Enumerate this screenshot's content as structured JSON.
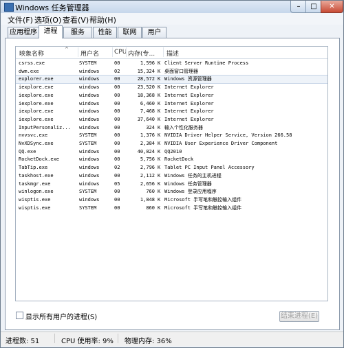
{
  "window": {
    "title": "Windows 任务管理器",
    "controls": {
      "minimize": "–",
      "maximize": "□",
      "close": "✕"
    }
  },
  "menu": [
    "文件(F)",
    "选项(O)",
    "查看(V)",
    "帮助(H)"
  ],
  "tabs": [
    "应用程序",
    "进程",
    "服务",
    "性能",
    "联网",
    "用户"
  ],
  "active_tab": "进程",
  "columns": {
    "name": "映象名称",
    "user": "用户名",
    "cpu": "CPU",
    "mem": "内存(专...",
    "desc": "描述"
  },
  "processes": [
    {
      "name": "csrss.exe",
      "user": "SYSTEM",
      "cpu": "00",
      "mem": "1,596",
      "unit": "K",
      "desc": "Client Server Runtime Process"
    },
    {
      "name": "dwm.exe",
      "user": "windows",
      "cpu": "02",
      "mem": "15,324",
      "unit": "K",
      "desc": "桌面窗口管理器"
    },
    {
      "name": "explorer.exe",
      "user": "windows",
      "cpu": "00",
      "mem": "28,572",
      "unit": "K",
      "desc": "Windows 资源管理器"
    },
    {
      "name": "iexplore.exe",
      "user": "windows",
      "cpu": "00",
      "mem": "23,520",
      "unit": "K",
      "desc": "Internet Explorer"
    },
    {
      "name": "iexplore.exe",
      "user": "windows",
      "cpu": "00",
      "mem": "18,368",
      "unit": "K",
      "desc": "Internet Explorer"
    },
    {
      "name": "iexplore.exe",
      "user": "windows",
      "cpu": "00",
      "mem": "6,460",
      "unit": "K",
      "desc": "Internet Explorer"
    },
    {
      "name": "iexplore.exe",
      "user": "windows",
      "cpu": "00",
      "mem": "7,468",
      "unit": "K",
      "desc": "Internet Explorer"
    },
    {
      "name": "iexplore.exe",
      "user": "windows",
      "cpu": "00",
      "mem": "37,640",
      "unit": "K",
      "desc": "Internet Explorer"
    },
    {
      "name": "InputPersonaliz...",
      "user": "windows",
      "cpu": "00",
      "mem": "324",
      "unit": "K",
      "desc": "输入个性化服务器"
    },
    {
      "name": "nvvsvc.exe",
      "user": "SYSTEM",
      "cpu": "00",
      "mem": "1,376",
      "unit": "K",
      "desc": "NVIDIA Driver Helper Service, Version 266.58"
    },
    {
      "name": "NvXDSync.exe",
      "user": "SYSTEM",
      "cpu": "00",
      "mem": "2,384",
      "unit": "K",
      "desc": "NVIDIA User Experience Driver Component"
    },
    {
      "name": "QQ.exe",
      "user": "windows",
      "cpu": "00",
      "mem": "40,824",
      "unit": "K",
      "desc": "QQ2010"
    },
    {
      "name": "RocketDock.exe",
      "user": "windows",
      "cpu": "00",
      "mem": "5,756",
      "unit": "K",
      "desc": "RocketDock"
    },
    {
      "name": "TabTip.exe",
      "user": "windows",
      "cpu": "02",
      "mem": "2,796",
      "unit": "K",
      "desc": "Tablet PC Input Panel Accessory"
    },
    {
      "name": "taskhost.exe",
      "user": "windows",
      "cpu": "00",
      "mem": "2,112",
      "unit": "K",
      "desc": "Windows 任务的主机进程"
    },
    {
      "name": "taskmgr.exe",
      "user": "windows",
      "cpu": "05",
      "mem": "2,656",
      "unit": "K",
      "desc": "Windows 任务管理器"
    },
    {
      "name": "winlogon.exe",
      "user": "SYSTEM",
      "cpu": "00",
      "mem": "760",
      "unit": "K",
      "desc": "Windows 登录应用程序"
    },
    {
      "name": "wisptis.exe",
      "user": "windows",
      "cpu": "00",
      "mem": "1,848",
      "unit": "K",
      "desc": "Microsoft 手写笔和触控输入组件"
    },
    {
      "name": "wisptis.exe",
      "user": "SYSTEM",
      "cpu": "00",
      "mem": "860",
      "unit": "K",
      "desc": "Microsoft 手写笔和触控输入组件"
    }
  ],
  "selected_process": "explorer.exe",
  "show_all_users": {
    "label": "显示所有用户的进程(S)",
    "checked": false
  },
  "end_process_label": "结束进程(E)",
  "status": {
    "processes": "进程数: 51",
    "cpu": "CPU 使用率: 9%",
    "memory": "物理内存: 36%"
  }
}
